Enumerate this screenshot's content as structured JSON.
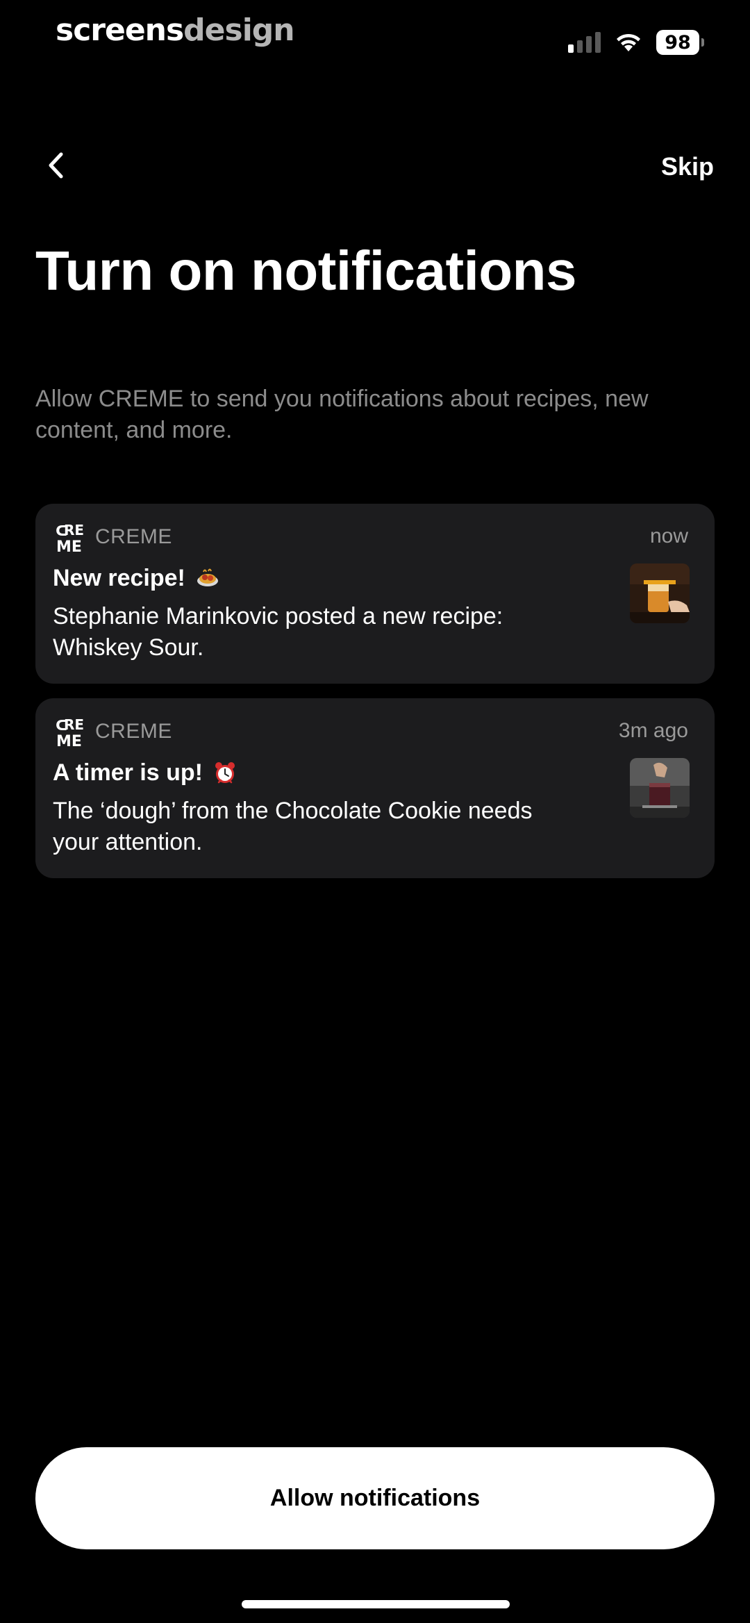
{
  "watermark": {
    "part1": "screens",
    "part2": "design"
  },
  "status_bar": {
    "signal_icon": "cellular-signal-icon",
    "wifi_icon": "wifi-icon",
    "battery_level": "98"
  },
  "nav": {
    "back_icon": "chevron-left-icon",
    "skip_label": "Skip"
  },
  "header": {
    "title": "Turn on notifications",
    "subtitle": "Allow CREME to send you notifications about recipes, new content, and more."
  },
  "notifications": [
    {
      "app_icon": "creme-logo-icon",
      "app_name": "CREME",
      "time": "now",
      "title": "New recipe!",
      "title_emoji": "spaghetti-icon",
      "body": "Stephanie Marinkovic posted a new recipe: Whiskey Sour.",
      "thumbnail": "whiskey-sour-thumbnail"
    },
    {
      "app_icon": "creme-logo-icon",
      "app_name": "CREME",
      "time": "3m ago",
      "title": "A timer is up!",
      "title_emoji": "alarm-clock-icon",
      "body": "The ‘dough’ from the Chocolate Cookie needs your attention.",
      "thumbnail": "cocktail-pour-thumbnail"
    }
  ],
  "cta": {
    "label": "Allow notifications"
  },
  "colors": {
    "background": "#000000",
    "card": "#1c1c1e",
    "subtitle": "#8c8c8c",
    "button": "#ffffff"
  }
}
